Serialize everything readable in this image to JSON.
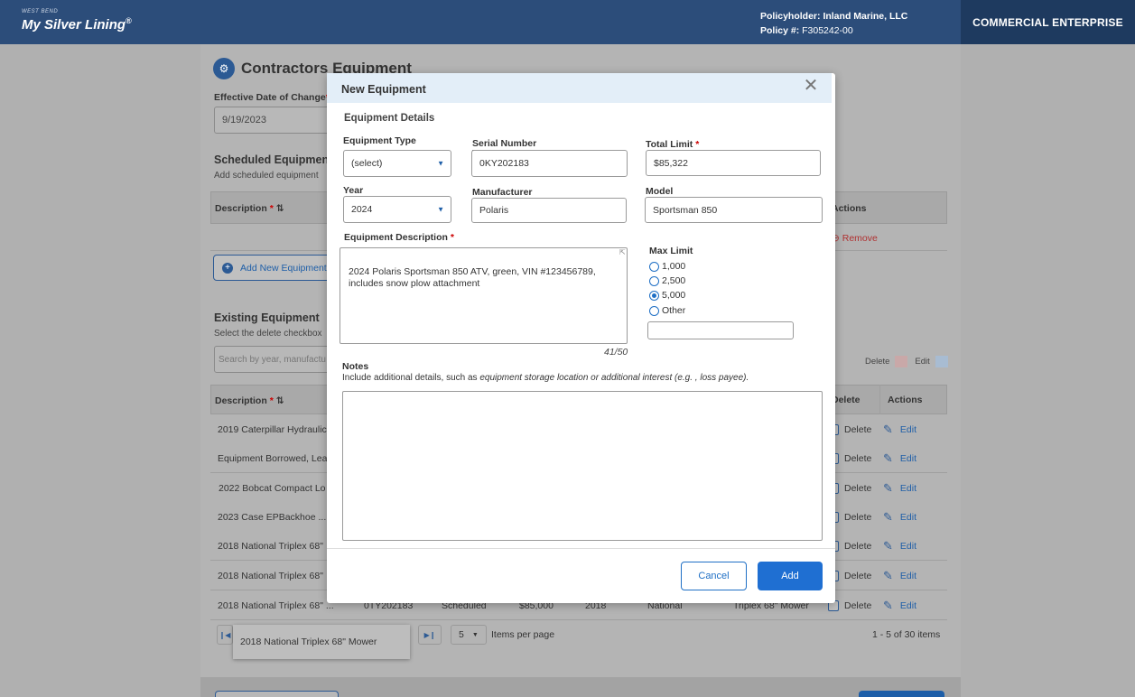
{
  "header": {
    "brand_small": "WEST BEND",
    "brand": "My Silver Lining",
    "brand_mark": "®",
    "policyholder_label": "Policyholder:",
    "policyholder_value": "Inland Marine, LLC",
    "policy_label": "Policy #:",
    "policy_value": "F305242-00",
    "right_title": "COMMERCIAL ENTERPRISE"
  },
  "page": {
    "title": "Contractors Equipment",
    "title_icon": "tools-icon",
    "effective_label": "Effective Date of Change",
    "effective_value": "9/19/2023",
    "scheduled_title": "Scheduled Equipment",
    "scheduled_sub": "Add scheduled equipment",
    "col_description": "Description",
    "col_actions": "Actions",
    "remove_label": "Remove",
    "add_new_label": "Add New Equipment",
    "existing_title": "Existing Equipment",
    "existing_sub": "Select the delete checkbox",
    "search_placeholder": "Search by year, manufactu",
    "legend_delete": "Delete",
    "legend_edit": "Edit",
    "col_delete": "Delete",
    "rows": [
      {
        "desc": "2019 Caterpillar Hydraulic"
      },
      {
        "desc": "Equipment Borrowed, Lea"
      },
      {
        "desc": "2022 Bobcat Compact Lo"
      },
      {
        "desc": "2023 Case EPBackhoe ..."
      },
      {
        "desc": "2018 National Triplex 68\""
      },
      {
        "desc": "2018 National Triplex 68\""
      },
      {
        "desc": "2018 National Triplex 68\" ...",
        "serial": "0TY202183",
        "type": "Scheduled",
        "limit": "$85,000",
        "year": "2018",
        "mfr": "National",
        "model": "Triplex 68\" Mower"
      }
    ],
    "delete_label": "Delete",
    "edit_label": "Edit",
    "pager_size": "5",
    "items_per_page": "Items per page",
    "items_count": "1 - 5 of 30 items",
    "tooltip": "2018 National Triplex 68\" Mower"
  },
  "modal": {
    "title": "New Equipment",
    "section": "Equipment Details",
    "type_label": "Equipment Type",
    "type_value": "(select)",
    "serial_label": "Serial Number",
    "serial_value": "0KY202183",
    "total_label": "Total Limit",
    "total_value": "$85,322",
    "year_label": "Year",
    "year_value": "2024",
    "mfr_label": "Manufacturer",
    "mfr_value": "Polaris",
    "model_label": "Model",
    "model_value": "Sportsman 850",
    "desc_label": "Equipment Description",
    "desc_value": "2024 Polaris Sportsman 850 ATV, green, VIN #123456789, includes snow plow attachment",
    "desc_count": "41/50",
    "max_label": "Max Limit",
    "max_options": [
      "1,000",
      "2,500",
      "5,000",
      "Other"
    ],
    "max_selected": "5,000",
    "notes_label": "Notes",
    "notes_help_a": "Include additional details, such as ",
    "notes_help_b": "equipment storage location or additional interest (e.g. , loss payee).",
    "cancel": "Cancel",
    "add": "Add"
  },
  "colors": {
    "header": "#2c4d7a",
    "accent": "#1f6fd2",
    "required": "#cc0000"
  }
}
